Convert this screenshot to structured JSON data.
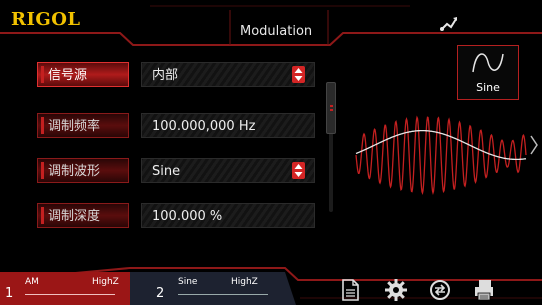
{
  "header": {
    "brand": "RIGOL",
    "title": "Modulation"
  },
  "rows": [
    {
      "label": "信号源",
      "value": "内部",
      "has_dropdown": true,
      "selected": true
    },
    {
      "label": "调制频率",
      "value": "100.000,000 Hz",
      "has_dropdown": false,
      "selected": false
    },
    {
      "label": "调制波形",
      "value": "Sine",
      "has_dropdown": true,
      "selected": false
    },
    {
      "label": "调制深度",
      "value": "100.000 %",
      "has_dropdown": false,
      "selected": false
    }
  ],
  "preview": {
    "waveform_label": "Sine"
  },
  "channels": [
    {
      "number": "1",
      "mode": "AM",
      "load": "HighZ",
      "active": true
    },
    {
      "number": "2",
      "mode": "Sine",
      "load": "HighZ",
      "active": false
    }
  ],
  "icons": [
    "usb-icon",
    "document-icon",
    "gear-icon",
    "sync-icon",
    "printer-icon",
    "chevron-right-icon"
  ],
  "colors": {
    "accent": "#c42020",
    "brand": "#f2c200",
    "background": "#000000"
  }
}
